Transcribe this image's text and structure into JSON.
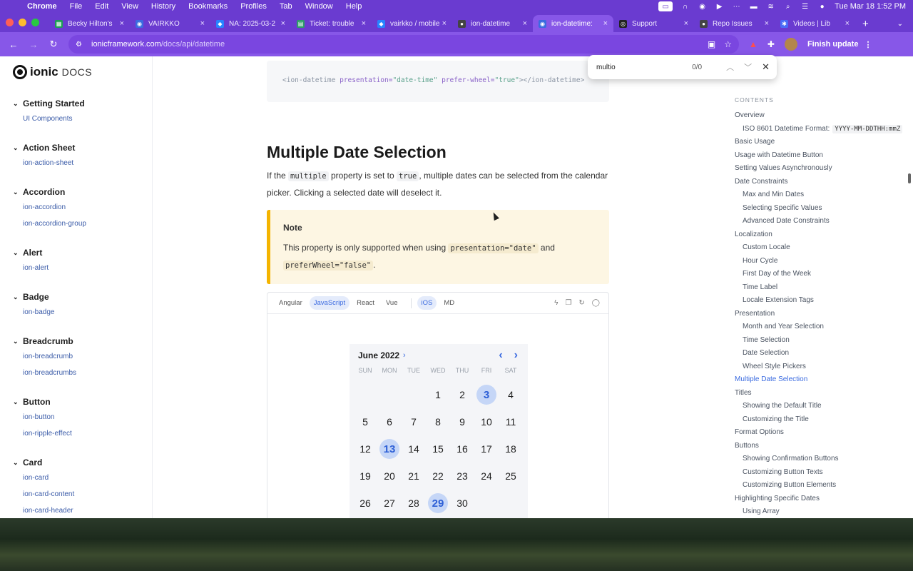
{
  "menubar": {
    "app": "Chrome",
    "items": [
      "File",
      "Edit",
      "View",
      "History",
      "Bookmarks",
      "Profiles",
      "Tab",
      "Window",
      "Help"
    ],
    "clock": "Tue Mar 18  1:52 PM"
  },
  "tabs": [
    {
      "label": "Becky Hilton's",
      "color": "#1e9e55",
      "glyph": "▦"
    },
    {
      "label": "VAIRKKO",
      "color": "#3b6be0",
      "glyph": "◉"
    },
    {
      "label": "NA: 2025-03-2",
      "color": "#2684ff",
      "glyph": "◆"
    },
    {
      "label": "Ticket: trouble",
      "color": "#2e9c6a",
      "glyph": "▤"
    },
    {
      "label": "vairkko / mobile",
      "color": "#2684ff",
      "glyph": "◆"
    },
    {
      "label": "ion-datetime",
      "color": "#444",
      "glyph": "●"
    },
    {
      "label": "ion-datetime:",
      "color": "#3b6be0",
      "glyph": "◉",
      "active": true
    },
    {
      "label": "Support",
      "color": "#222",
      "glyph": "◎"
    },
    {
      "label": "Repo Issues",
      "color": "#444",
      "glyph": "●"
    },
    {
      "label": "Videos | Lib",
      "color": "#4a6cf7",
      "glyph": "✱"
    }
  ],
  "toolbar": {
    "url_host": "ionicframework.com",
    "url_path": "/docs/api/datetime",
    "update_label": "Finish update"
  },
  "find": {
    "query": "multio",
    "count": "0/0"
  },
  "logo": {
    "word": "ionic",
    "docs": "DOCS"
  },
  "sidebar": [
    {
      "title": "Getting Started",
      "links": [
        "UI Components"
      ]
    },
    {
      "title": "Action Sheet",
      "links": [
        "ion-action-sheet"
      ]
    },
    {
      "title": "Accordion",
      "links": [
        "ion-accordion",
        "ion-accordion-group"
      ]
    },
    {
      "title": "Alert",
      "links": [
        "ion-alert"
      ]
    },
    {
      "title": "Badge",
      "links": [
        "ion-badge"
      ]
    },
    {
      "title": "Breadcrumb",
      "links": [
        "ion-breadcrumb",
        "ion-breadcrumbs"
      ]
    },
    {
      "title": "Button",
      "links": [
        "ion-button",
        "ion-ripple-effect"
      ]
    },
    {
      "title": "Card",
      "links": [
        "ion-card",
        "ion-card-content",
        "ion-card-header"
      ]
    }
  ],
  "code": {
    "tag_open": "<ion-datetime",
    "attr1": "presentation=",
    "val1": "\"date-time\"",
    "attr2": "prefer-wheel=",
    "val2": "\"true\"",
    "tag_close": "></ion-datetime>"
  },
  "content": {
    "heading": "Multiple Date Selection",
    "para_1": "If the",
    "code_multiple": "multiple",
    "para_2": "property is set to",
    "code_true": "true",
    "para_3": ", multiple dates can be selected from the calendar picker. Clicking a selected date will deselect it.",
    "note_title": "Note",
    "note_1": "This property is only supported when using",
    "note_code1": "presentation=\"date\"",
    "note_2": "and",
    "note_code2": "preferWheel=\"false\"",
    "note_3": "."
  },
  "demo": {
    "frameworks": [
      "Angular",
      "JavaScript",
      "React",
      "Vue"
    ],
    "selected_framework": "JavaScript",
    "modes": [
      "iOS",
      "MD"
    ],
    "selected_mode": "iOS"
  },
  "calendar": {
    "month": "June 2022",
    "weekdays": [
      "SUN",
      "MON",
      "TUE",
      "WED",
      "THU",
      "FRI",
      "SAT"
    ],
    "first_weekday_index": 3,
    "days": 30,
    "selected": [
      3,
      13,
      29
    ]
  },
  "toc": {
    "title": "CONTENTS",
    "items": [
      {
        "label": "Overview",
        "level": 0
      },
      {
        "label": "ISO 8601 Datetime Format:",
        "code": "YYYY-MM-DDTHH:mmZ",
        "level": 1
      },
      {
        "label": "Basic Usage",
        "level": 0
      },
      {
        "label": "Usage with Datetime Button",
        "level": 0
      },
      {
        "label": "Setting Values Asynchronously",
        "level": 0
      },
      {
        "label": "Date Constraints",
        "level": 0
      },
      {
        "label": "Max and Min Dates",
        "level": 1
      },
      {
        "label": "Selecting Specific Values",
        "level": 1
      },
      {
        "label": "Advanced Date Constraints",
        "level": 1
      },
      {
        "label": "Localization",
        "level": 0
      },
      {
        "label": "Custom Locale",
        "level": 1
      },
      {
        "label": "Hour Cycle",
        "level": 1
      },
      {
        "label": "First Day of the Week",
        "level": 1
      },
      {
        "label": "Time Label",
        "level": 1
      },
      {
        "label": "Locale Extension Tags",
        "level": 1
      },
      {
        "label": "Presentation",
        "level": 0
      },
      {
        "label": "Month and Year Selection",
        "level": 1
      },
      {
        "label": "Time Selection",
        "level": 1
      },
      {
        "label": "Date Selection",
        "level": 1
      },
      {
        "label": "Wheel Style Pickers",
        "level": 1
      },
      {
        "label": "Multiple Date Selection",
        "level": 0,
        "active": true
      },
      {
        "label": "Titles",
        "level": 0
      },
      {
        "label": "Showing the Default Title",
        "level": 1
      },
      {
        "label": "Customizing the Title",
        "level": 1
      },
      {
        "label": "Format Options",
        "level": 0
      },
      {
        "label": "Buttons",
        "level": 0
      },
      {
        "label": "Showing Confirmation Buttons",
        "level": 1
      },
      {
        "label": "Customizing Button Texts",
        "level": 1
      },
      {
        "label": "Customizing Button Elements",
        "level": 1
      },
      {
        "label": "Highlighting Specific Dates",
        "level": 0
      },
      {
        "label": "Using Array",
        "level": 1
      }
    ]
  },
  "colors": {
    "browser_chrome": "#6a3bd0",
    "accent": "#3b6be0",
    "note_border": "#f4b400"
  }
}
